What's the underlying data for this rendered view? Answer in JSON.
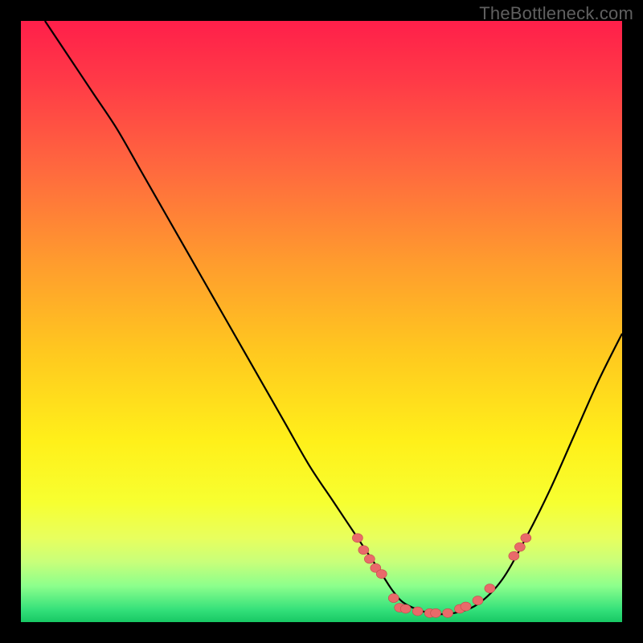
{
  "watermark": "TheBottleneck.com",
  "colors": {
    "background": "#000000",
    "curve": "#000000",
    "marker_fill": "#e96a6a",
    "marker_stroke": "#c24a4a",
    "gradient_top": "#ff1f4a",
    "gradient_bottom": "#18c864"
  },
  "chart_data": {
    "type": "line",
    "title": "",
    "xlabel": "",
    "ylabel": "",
    "xlim": [
      0,
      100
    ],
    "ylim": [
      0,
      100
    ],
    "grid": false,
    "series": [
      {
        "name": "bottleneck-curve",
        "x": [
          4,
          8,
          12,
          16,
          20,
          24,
          28,
          32,
          36,
          40,
          44,
          48,
          52,
          56,
          60,
          62,
          64,
          68,
          72,
          76,
          80,
          84,
          88,
          92,
          96,
          100
        ],
        "y": [
          100,
          94,
          88,
          82,
          75,
          68,
          61,
          54,
          47,
          40,
          33,
          26,
          20,
          14,
          8,
          5,
          3,
          1.5,
          1.5,
          3,
          7,
          14,
          22,
          31,
          40,
          48
        ]
      }
    ],
    "markers": [
      {
        "x": 56,
        "y": 14
      },
      {
        "x": 57,
        "y": 12
      },
      {
        "x": 58,
        "y": 10.5
      },
      {
        "x": 59,
        "y": 9
      },
      {
        "x": 60,
        "y": 8
      },
      {
        "x": 62,
        "y": 4
      },
      {
        "x": 63,
        "y": 2.4
      },
      {
        "x": 64,
        "y": 2.2
      },
      {
        "x": 66,
        "y": 1.8
      },
      {
        "x": 68,
        "y": 1.5
      },
      {
        "x": 69,
        "y": 1.5
      },
      {
        "x": 71,
        "y": 1.5
      },
      {
        "x": 73,
        "y": 2.2
      },
      {
        "x": 74,
        "y": 2.6
      },
      {
        "x": 76,
        "y": 3.6
      },
      {
        "x": 78,
        "y": 5.6
      },
      {
        "x": 82,
        "y": 11
      },
      {
        "x": 83,
        "y": 12.5
      },
      {
        "x": 84,
        "y": 14
      }
    ]
  }
}
